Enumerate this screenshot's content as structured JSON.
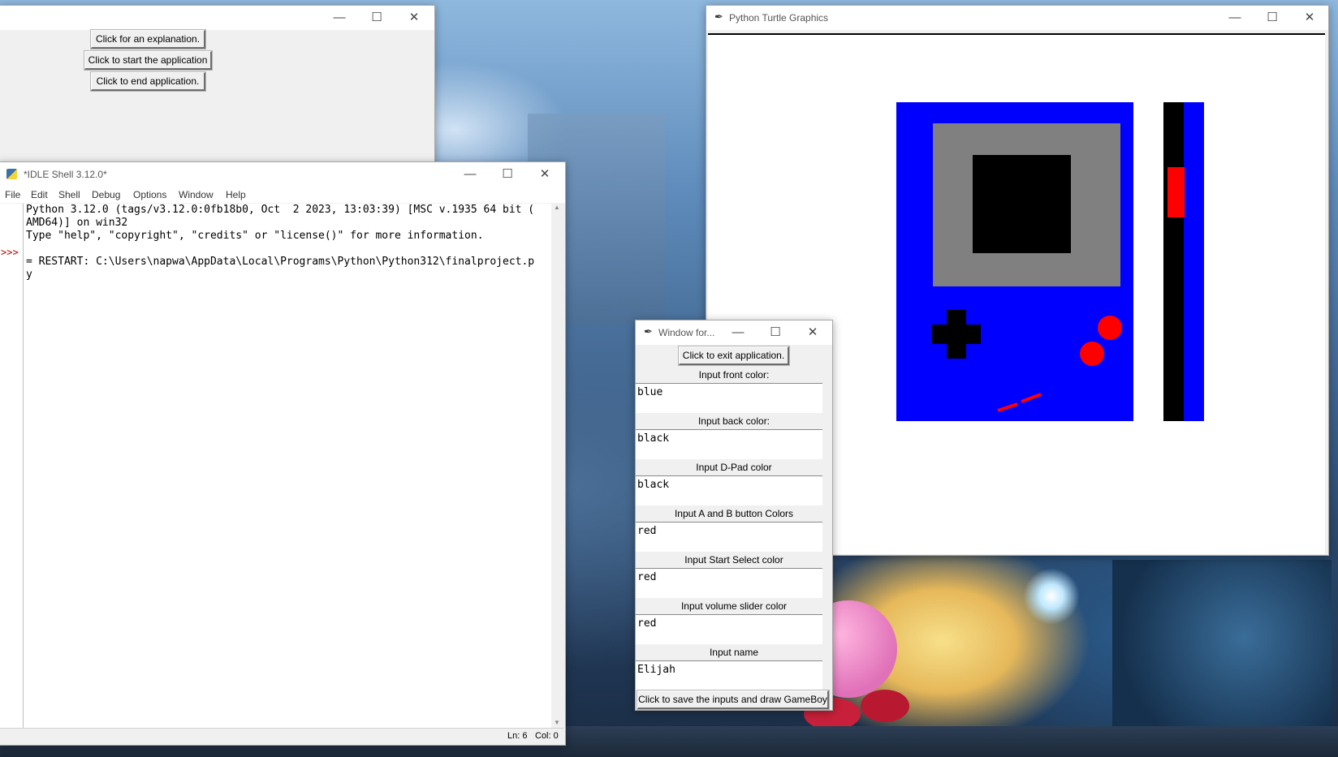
{
  "launcher_window": {
    "title": "",
    "buttons": [
      "Click for an explanation.",
      "Click to start the application",
      "Click to end application."
    ]
  },
  "idle_window": {
    "title": "*IDLE Shell 3.12.0*",
    "menu": [
      "File",
      "Edit",
      "Shell",
      "Debug",
      "Options",
      "Window",
      "Help"
    ],
    "prompt": ">>>",
    "lines": [
      "Python 3.12.0 (tags/v3.12.0:0fb18b0, Oct  2 2023, 13:03:39) [MSC v.1935 64 bit (",
      "AMD64)] on win32",
      "Type \"help\", \"copyright\", \"credits\" or \"license()\" for more information.",
      "= RESTART: C:\\Users\\napwa\\AppData\\Local\\Programs\\Python\\Python312\\finalproject.p",
      "y"
    ],
    "status_ln": "Ln: 6",
    "status_col": "Col: 0"
  },
  "turtle_window": {
    "title": "Python Turtle Graphics",
    "gameboy": {
      "front_color": "#0000ff",
      "screen_frame_color": "#808080",
      "screen_color": "#000000",
      "dpad_color": "#000000",
      "button_color": "#ff0000",
      "start_select_color": "#ff0000",
      "back_color": "#000000",
      "slider_color": "#ff0000"
    }
  },
  "input_window": {
    "title": "Window for...",
    "exit_button": "Click to exit application.",
    "fields": [
      {
        "label": "Input front color:",
        "value": "blue"
      },
      {
        "label": "Input back color:",
        "value": "black"
      },
      {
        "label": "Input D-Pad color",
        "value": "black"
      },
      {
        "label": "Input A and B button Colors",
        "value": "red"
      },
      {
        "label": "Input Start Select color",
        "value": "red"
      },
      {
        "label": "Input volume slider color",
        "value": "red"
      },
      {
        "label": "Input name",
        "value": "Elijah"
      }
    ],
    "save_button": "Click to save the inputs and draw GameBoy"
  }
}
